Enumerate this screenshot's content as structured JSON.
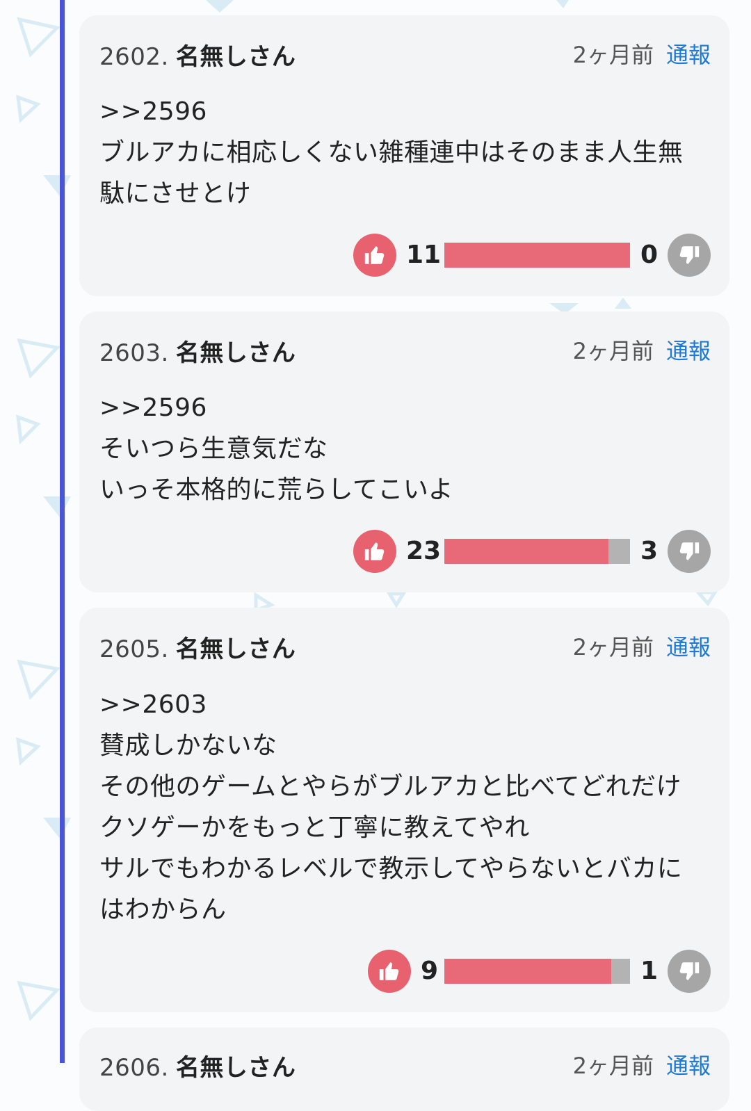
{
  "posts": [
    {
      "number": "2602.",
      "author": "名無しさん",
      "time": "2ヶ月前",
      "report": "通報",
      "lines": [
        ">>2596",
        "ブルアカに相応しくない雑種連中はそのまま人生無",
        "駄にさせとけ"
      ],
      "likes": "11",
      "dislikes": "0",
      "like_ratio": 1.0
    },
    {
      "number": "2603.",
      "author": "名無しさん",
      "time": "2ヶ月前",
      "report": "通報",
      "lines": [
        ">>2596",
        "そいつら生意気だな",
        "いっそ本格的に荒らしてこいよ"
      ],
      "likes": "23",
      "dislikes": "3",
      "like_ratio": 0.885
    },
    {
      "number": "2605.",
      "author": "名無しさん",
      "time": "2ヶ月前",
      "report": "通報",
      "lines": [
        ">>2603",
        "賛成しかないな",
        "その他のゲームとやらがブルアカと比べてどれだけ",
        "クソゲーかをもっと丁寧に教えてやれ",
        "サルでもわかるレベルで教示してやらないとバカに",
        "はわからん"
      ],
      "likes": "9",
      "dislikes": "1",
      "like_ratio": 0.9
    },
    {
      "number": "2606.",
      "author": "名無しさん",
      "time": "2ヶ月前",
      "report": "通報"
    }
  ],
  "icons": {
    "like": "thumbs-up-icon",
    "dislike": "thumbs-down-icon"
  },
  "colors": {
    "rail": "#4a55d6",
    "like": "#e8616f",
    "bar_like": "#e86a79",
    "bar_dislike": "#b3b3b3",
    "dislike": "#a6a6a6",
    "report_link": "#1f7ad6"
  }
}
